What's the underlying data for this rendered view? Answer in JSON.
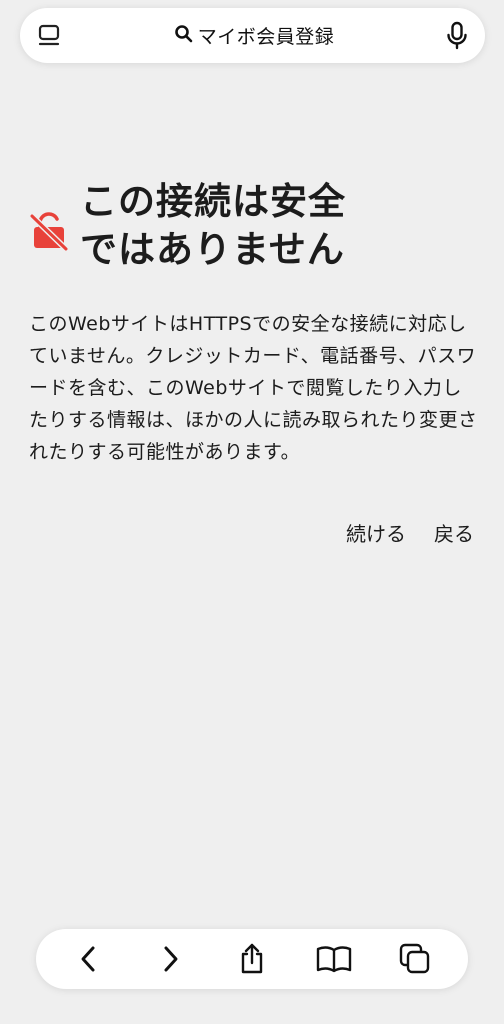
{
  "address_bar": {
    "text": "マイボ会員登録",
    "tabs_icon": "sidebar-icon",
    "search_icon": "search-icon",
    "mic_icon": "microphone-icon"
  },
  "warning": {
    "title": "この接続は安全\nではありません",
    "body": "このWebサイトはHTTPSでの安全な接続に対応していません。クレジットカード、電話番号、パスワードを含む、このWebサイトで閲覧したり入力したりする情報は、ほかの人に読み取られたり変更されたりする可能性があります。",
    "continue_label": "続ける",
    "back_label": "戻る",
    "icon": "unlocked-warning-icon",
    "icon_color": "#e8423a"
  },
  "toolbar": {
    "icons": [
      "back-icon",
      "forward-icon",
      "share-icon",
      "bookmarks-icon",
      "tabs-icon"
    ]
  }
}
